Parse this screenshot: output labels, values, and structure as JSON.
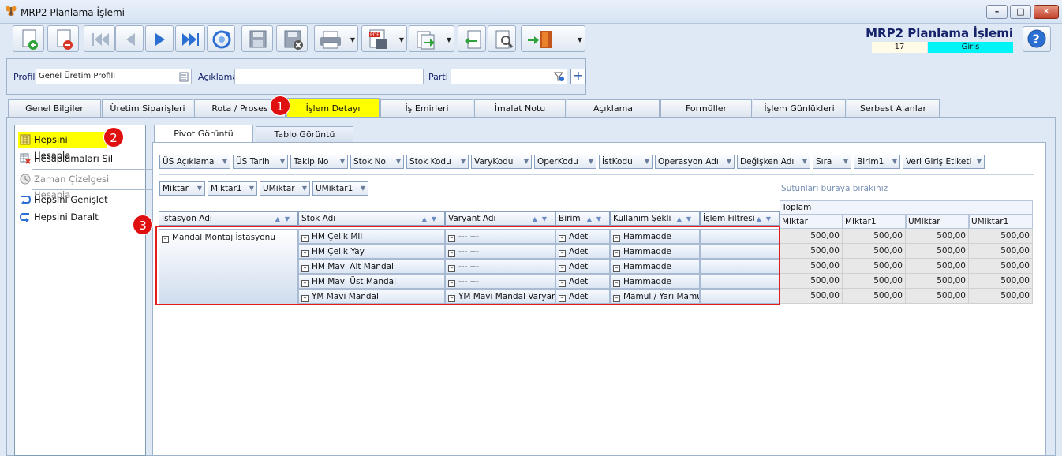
{
  "window": {
    "title": "MRP2 Planlama İşlemi"
  },
  "header": {
    "form_title": "MRP2 Planlama İşlemi",
    "record_no": "17",
    "mode": "Giriş"
  },
  "toolbar": {
    "buttons": [
      "new-document-icon",
      "delete-document-icon",
      "first-record-icon",
      "previous-record-icon",
      "next-record-icon",
      "last-record-icon",
      "refresh-icon",
      "save-icon",
      "cancel-save-icon",
      "print-icon",
      "pdf-export-icon",
      "export-icon",
      "import-icon",
      "settings-icon",
      "exit-icon"
    ]
  },
  "filter": {
    "profile_label": "Profil",
    "profile_value": "Genel Üretim Profili",
    "description_label": "Açıklama",
    "description_value": "",
    "lot_label": "Parti",
    "lot_value": ""
  },
  "tabs": [
    "Genel Bilgiler",
    "Üretim Siparişleri",
    "Rota / Proses",
    "İşlem Detayı",
    "İş Emirleri",
    "İmalat Notu",
    "Açıklama",
    "Formüller",
    "İşlem Günlükleri",
    "Serbest Alanlar"
  ],
  "active_tab": "İşlem Detayı",
  "left_menu": {
    "items": [
      "Hepsini Hesapla",
      "Hesaplamaları Sil",
      "Zaman Çizelgesi Hesapla",
      "Hepsini Genişlet",
      "Hepsini Daralt"
    ]
  },
  "subtabs": [
    "Pivot Görüntü",
    "Tablo Görüntü"
  ],
  "pivot": {
    "filter_fields": [
      "ÜS Açıklama",
      "ÜS Tarih",
      "Takip No",
      "Stok No",
      "Stok Kodu",
      "VaryKodu",
      "OperKodu",
      "İstKodu",
      "Operasyon Adı",
      "Değişken Adı",
      "Sıra",
      "Birim1",
      "Veri Giriş Etiketi"
    ],
    "data_fields": [
      "Miktar",
      "Miktar1",
      "UMiktar",
      "UMiktar1"
    ],
    "drop_hint": "Sütunları buraya bırakınız",
    "row_fields": [
      "İstasyon Adı",
      "Stok Adı",
      "Varyant Adı",
      "Birim",
      "Kullanım Şekli",
      "İşlem Filtresi"
    ],
    "total_label": "Toplam",
    "value_columns": [
      "Miktar",
      "Miktar1",
      "UMiktar",
      "UMiktar1"
    ],
    "station": "Mandal Montaj İstasyonu",
    "rows": [
      {
        "stock": "HM Çelik Mil",
        "variant": "--- ---",
        "unit": "Adet",
        "usage": "Hammadde",
        "values": [
          "500,00",
          "500,00",
          "500,00",
          "500,00"
        ]
      },
      {
        "stock": "HM Çelik Yay",
        "variant": "--- ---",
        "unit": "Adet",
        "usage": "Hammadde",
        "values": [
          "500,00",
          "500,00",
          "500,00",
          "500,00"
        ]
      },
      {
        "stock": "HM Mavi Alt Mandal",
        "variant": "--- ---",
        "unit": "Adet",
        "usage": "Hammadde",
        "values": [
          "500,00",
          "500,00",
          "500,00",
          "500,00"
        ]
      },
      {
        "stock": "HM Mavi Üst Mandal",
        "variant": "--- ---",
        "unit": "Adet",
        "usage": "Hammadde",
        "values": [
          "500,00",
          "500,00",
          "500,00",
          "500,00"
        ]
      },
      {
        "stock": "YM Mavi Mandal",
        "variant": "YM Mavi Mandal Varyantı",
        "unit": "Adet",
        "usage": "Mamul / Yarı Mamul",
        "values": [
          "500,00",
          "500,00",
          "500,00",
          "500,00"
        ]
      }
    ]
  },
  "annotations": [
    "1",
    "2",
    "3"
  ],
  "colors": {
    "highlight": "#ffff00",
    "mode_bg": "#00f3f7",
    "annotation": "#e01010",
    "title_text": "#16226a"
  }
}
